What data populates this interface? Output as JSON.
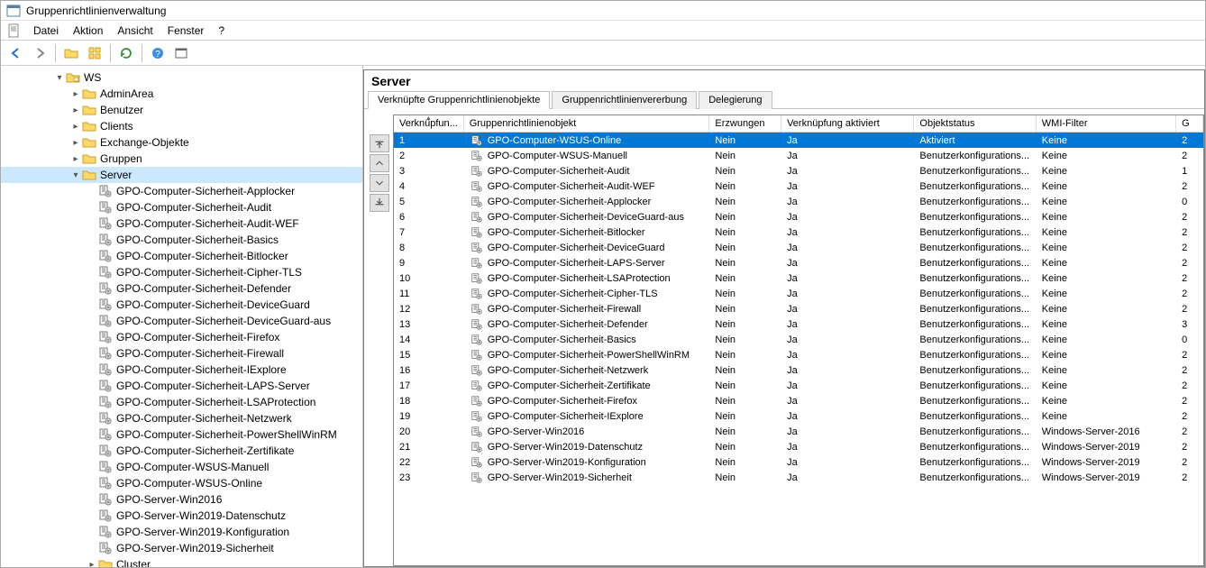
{
  "window": {
    "title": "Gruppenrichtlinienverwaltung"
  },
  "menu": {
    "datei": "Datei",
    "aktion": "Aktion",
    "ansicht": "Ansicht",
    "fenster": "Fenster",
    "help": "?"
  },
  "tree": {
    "root": "WS",
    "ous": [
      "AdminArea",
      "Benutzer",
      "Clients",
      "Exchange-Objekte",
      "Gruppen",
      "Server"
    ],
    "server_gpos": [
      "GPO-Computer-Sicherheit-Applocker",
      "GPO-Computer-Sicherheit-Audit",
      "GPO-Computer-Sicherheit-Audit-WEF",
      "GPO-Computer-Sicherheit-Basics",
      "GPO-Computer-Sicherheit-Bitlocker",
      "GPO-Computer-Sicherheit-Cipher-TLS",
      "GPO-Computer-Sicherheit-Defender",
      "GPO-Computer-Sicherheit-DeviceGuard",
      "GPO-Computer-Sicherheit-DeviceGuard-aus",
      "GPO-Computer-Sicherheit-Firefox",
      "GPO-Computer-Sicherheit-Firewall",
      "GPO-Computer-Sicherheit-IExplore",
      "GPO-Computer-Sicherheit-LAPS-Server",
      "GPO-Computer-Sicherheit-LSAProtection",
      "GPO-Computer-Sicherheit-Netzwerk",
      "GPO-Computer-Sicherheit-PowerShellWinRM",
      "GPO-Computer-Sicherheit-Zertifikate",
      "GPO-Computer-WSUS-Manuell",
      "GPO-Computer-WSUS-Online",
      "GPO-Server-Win2016",
      "GPO-Server-Win2019-Datenschutz",
      "GPO-Server-Win2019-Konfiguration",
      "GPO-Server-Win2019-Sicherheit"
    ],
    "next_ou": "Cluster"
  },
  "panel": {
    "title": "Server",
    "tabs": [
      "Verknüpfte Gruppenrichtlinienobjekte",
      "Gruppenrichtlinienvererbung",
      "Delegierung"
    ]
  },
  "grid": {
    "headers": [
      "Verknüpfun...",
      "Gruppenrichtlinienobjekt",
      "Erzwungen",
      "Verknüpfung aktiviert",
      "Objektstatus",
      "WMI-Filter",
      "G"
    ],
    "rows": [
      {
        "order": "1",
        "gpo": "GPO-Computer-WSUS-Online",
        "erzwungen": "Nein",
        "aktiviert": "Ja",
        "status": "Aktiviert",
        "wmi": "Keine",
        "g": "2"
      },
      {
        "order": "2",
        "gpo": "GPO-Computer-WSUS-Manuell",
        "erzwungen": "Nein",
        "aktiviert": "Ja",
        "status": "Benutzerkonfigurations...",
        "wmi": "Keine",
        "g": "2"
      },
      {
        "order": "3",
        "gpo": "GPO-Computer-Sicherheit-Audit",
        "erzwungen": "Nein",
        "aktiviert": "Ja",
        "status": "Benutzerkonfigurations...",
        "wmi": "Keine",
        "g": "1"
      },
      {
        "order": "4",
        "gpo": "GPO-Computer-Sicherheit-Audit-WEF",
        "erzwungen": "Nein",
        "aktiviert": "Ja",
        "status": "Benutzerkonfigurations...",
        "wmi": "Keine",
        "g": "2"
      },
      {
        "order": "5",
        "gpo": "GPO-Computer-Sicherheit-Applocker",
        "erzwungen": "Nein",
        "aktiviert": "Ja",
        "status": "Benutzerkonfigurations...",
        "wmi": "Keine",
        "g": "0"
      },
      {
        "order": "6",
        "gpo": "GPO-Computer-Sicherheit-DeviceGuard-aus",
        "erzwungen": "Nein",
        "aktiviert": "Ja",
        "status": "Benutzerkonfigurations...",
        "wmi": "Keine",
        "g": "2"
      },
      {
        "order": "7",
        "gpo": "GPO-Computer-Sicherheit-Bitlocker",
        "erzwungen": "Nein",
        "aktiviert": "Ja",
        "status": "Benutzerkonfigurations...",
        "wmi": "Keine",
        "g": "2"
      },
      {
        "order": "8",
        "gpo": "GPO-Computer-Sicherheit-DeviceGuard",
        "erzwungen": "Nein",
        "aktiviert": "Ja",
        "status": "Benutzerkonfigurations...",
        "wmi": "Keine",
        "g": "2"
      },
      {
        "order": "9",
        "gpo": "GPO-Computer-Sicherheit-LAPS-Server",
        "erzwungen": "Nein",
        "aktiviert": "Ja",
        "status": "Benutzerkonfigurations...",
        "wmi": "Keine",
        "g": "2"
      },
      {
        "order": "10",
        "gpo": "GPO-Computer-Sicherheit-LSAProtection",
        "erzwungen": "Nein",
        "aktiviert": "Ja",
        "status": "Benutzerkonfigurations...",
        "wmi": "Keine",
        "g": "2"
      },
      {
        "order": "11",
        "gpo": "GPO-Computer-Sicherheit-Cipher-TLS",
        "erzwungen": "Nein",
        "aktiviert": "Ja",
        "status": "Benutzerkonfigurations...",
        "wmi": "Keine",
        "g": "2"
      },
      {
        "order": "12",
        "gpo": "GPO-Computer-Sicherheit-Firewall",
        "erzwungen": "Nein",
        "aktiviert": "Ja",
        "status": "Benutzerkonfigurations...",
        "wmi": "Keine",
        "g": "2"
      },
      {
        "order": "13",
        "gpo": "GPO-Computer-Sicherheit-Defender",
        "erzwungen": "Nein",
        "aktiviert": "Ja",
        "status": "Benutzerkonfigurations...",
        "wmi": "Keine",
        "g": "3"
      },
      {
        "order": "14",
        "gpo": "GPO-Computer-Sicherheit-Basics",
        "erzwungen": "Nein",
        "aktiviert": "Ja",
        "status": "Benutzerkonfigurations...",
        "wmi": "Keine",
        "g": "0"
      },
      {
        "order": "15",
        "gpo": "GPO-Computer-Sicherheit-PowerShellWinRM",
        "erzwungen": "Nein",
        "aktiviert": "Ja",
        "status": "Benutzerkonfigurations...",
        "wmi": "Keine",
        "g": "2"
      },
      {
        "order": "16",
        "gpo": "GPO-Computer-Sicherheit-Netzwerk",
        "erzwungen": "Nein",
        "aktiviert": "Ja",
        "status": "Benutzerkonfigurations...",
        "wmi": "Keine",
        "g": "2"
      },
      {
        "order": "17",
        "gpo": "GPO-Computer-Sicherheit-Zertifikate",
        "erzwungen": "Nein",
        "aktiviert": "Ja",
        "status": "Benutzerkonfigurations...",
        "wmi": "Keine",
        "g": "2"
      },
      {
        "order": "18",
        "gpo": "GPO-Computer-Sicherheit-Firefox",
        "erzwungen": "Nein",
        "aktiviert": "Ja",
        "status": "Benutzerkonfigurations...",
        "wmi": "Keine",
        "g": "2"
      },
      {
        "order": "19",
        "gpo": "GPO-Computer-Sicherheit-IExplore",
        "erzwungen": "Nein",
        "aktiviert": "Ja",
        "status": "Benutzerkonfigurations...",
        "wmi": "Keine",
        "g": "2"
      },
      {
        "order": "20",
        "gpo": "GPO-Server-Win2016",
        "erzwungen": "Nein",
        "aktiviert": "Ja",
        "status": "Benutzerkonfigurations...",
        "wmi": "Windows-Server-2016",
        "g": "2"
      },
      {
        "order": "21",
        "gpo": "GPO-Server-Win2019-Datenschutz",
        "erzwungen": "Nein",
        "aktiviert": "Ja",
        "status": "Benutzerkonfigurations...",
        "wmi": "Windows-Server-2019",
        "g": "2"
      },
      {
        "order": "22",
        "gpo": "GPO-Server-Win2019-Konfiguration",
        "erzwungen": "Nein",
        "aktiviert": "Ja",
        "status": "Benutzerkonfigurations...",
        "wmi": "Windows-Server-2019",
        "g": "2"
      },
      {
        "order": "23",
        "gpo": "GPO-Server-Win2019-Sicherheit",
        "erzwungen": "Nein",
        "aktiviert": "Ja",
        "status": "Benutzerkonfigurations...",
        "wmi": "Windows-Server-2019",
        "g": "2"
      }
    ]
  }
}
